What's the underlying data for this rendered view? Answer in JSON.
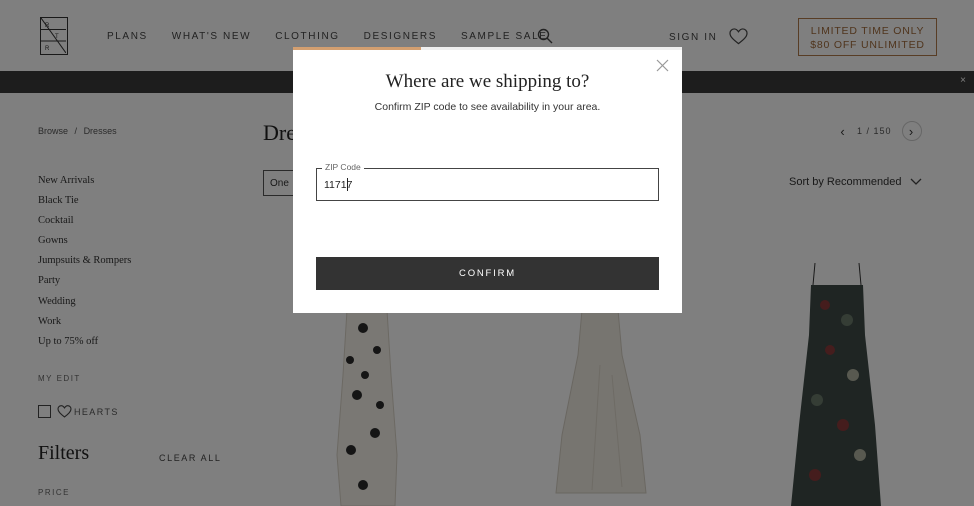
{
  "header": {
    "logo_letters": [
      "R",
      "T",
      "R"
    ],
    "nav": [
      "PLANS",
      "WHAT'S NEW",
      "CLOTHING",
      "DESIGNERS",
      "SAMPLE SALE"
    ],
    "sign_in": "SIGN IN",
    "promo_line1": "LIMITED TIME ONLY",
    "promo_line2": "$80 OFF UNLIMITED",
    "banner_close": "×"
  },
  "breadcrumb": [
    "Browse",
    "/",
    "Dresses"
  ],
  "categories": [
    "New Arrivals",
    "Black Tie",
    "Cocktail",
    "Gowns",
    "Jumpsuits & Rompers",
    "Party",
    "Wedding",
    "Work",
    "Up to 75% off"
  ],
  "my_edit_label": "MY EDIT",
  "hearts_label": "HEARTS",
  "filters": {
    "title": "Filters",
    "clear_all": "CLEAR ALL",
    "sub_label": "PRICE"
  },
  "main": {
    "page_title": "Dresses",
    "pager_text": "1 / 150",
    "filter_select": "One",
    "sort_label": "Sort by Recommended"
  },
  "modal": {
    "title": "Where are we shipping to?",
    "subtitle": "Confirm ZIP code to see availability in your area.",
    "zip_label": "ZIP Code",
    "zip_value": "11717",
    "confirm_label": "CONFIRM",
    "progress_fraction": 0.33
  },
  "colors": {
    "accent": "#d39f70",
    "promo": "#a06a3a",
    "button": "#333333",
    "banner": "#3a3a3a"
  }
}
